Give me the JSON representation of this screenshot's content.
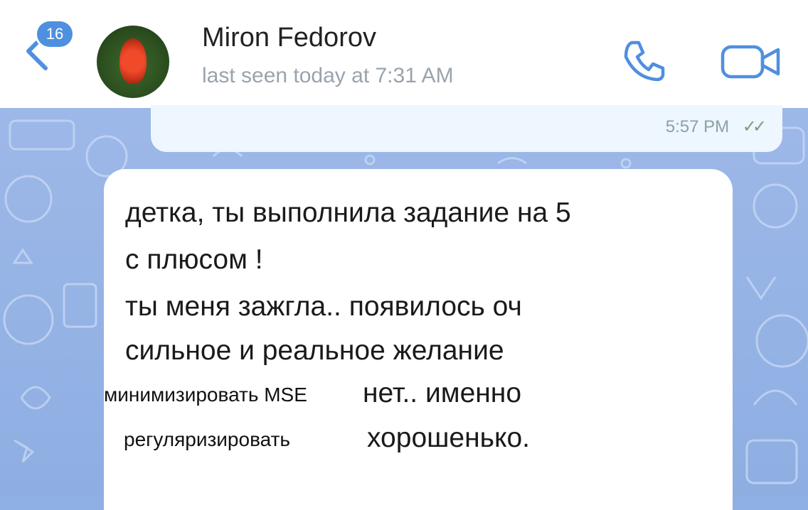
{
  "header": {
    "unread_badge": "16",
    "contact_name": "Miron Fedorov",
    "contact_status": "last seen today at 7:31 AM"
  },
  "outgoing_message": {
    "time": "5:57 PM",
    "ticks": "✓✓"
  },
  "incoming_message": {
    "lines": [
      "детка, ты выполнила задание на 5",
      "с плюсом !",
      "ты меня зажгла.. появилось оч",
      "сильное и реальное желание",
      "нет.. именно",
      "хорошенько."
    ]
  },
  "overlays": {
    "top": "минимизировать MSE",
    "bottom": "регуляризировать"
  },
  "colors": {
    "header_bg": "#ffffff",
    "chat_bg": "#8fb0e3",
    "accent": "#4f8fe0"
  }
}
